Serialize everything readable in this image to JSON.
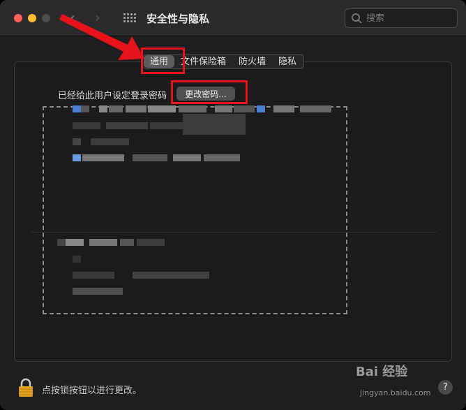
{
  "window": {
    "title": "安全性与隐私",
    "search_placeholder": "搜索"
  },
  "tabs": [
    {
      "label": "通用",
      "active": true
    },
    {
      "label": "文件保险箱",
      "active": false
    },
    {
      "label": "防火墙",
      "active": false
    },
    {
      "label": "隐私",
      "active": false
    }
  ],
  "general": {
    "password_label": "已经给此用户设定登录密码",
    "change_password_button": "更改密码..."
  },
  "footer": {
    "lock_text": "点按锁按钮以进行更改。",
    "help_label": "?"
  },
  "watermark": {
    "logo_text": "Bai 经验",
    "url": "jingyan.baidu.com"
  },
  "colors": {
    "accent_red": "#e8121b",
    "traffic_red": "#ff5f57",
    "traffic_yellow": "#febc2e",
    "lock_gold": "#e0a020"
  },
  "icons": {
    "back": "chevron-left-icon",
    "forward": "chevron-right-icon",
    "grid": "show-all-grid-icon",
    "search": "search-icon",
    "lock": "lock-icon",
    "help": "help-icon"
  }
}
